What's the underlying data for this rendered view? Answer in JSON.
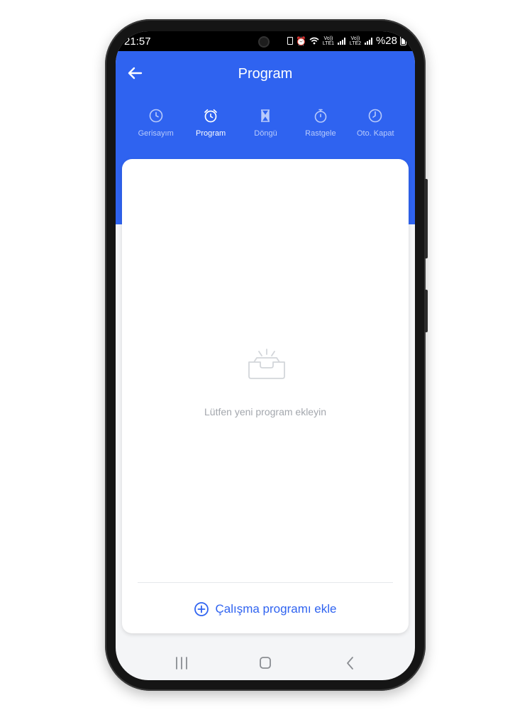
{
  "status": {
    "time": "21:57",
    "carrier1": "Vo)) LTE1",
    "carrier2": "Vo)) LTE2",
    "battery": "%28"
  },
  "header": {
    "title": "Program"
  },
  "tabs": [
    {
      "label": "Gerisayım",
      "icon": "clock-icon",
      "active": false
    },
    {
      "label": "Program",
      "icon": "alarm-clock-icon",
      "active": true
    },
    {
      "label": "Döngü",
      "icon": "hourglass-icon",
      "active": false
    },
    {
      "label": "Rastgele",
      "icon": "stopwatch-icon",
      "active": false
    },
    {
      "label": "Oto. Kapat",
      "icon": "timer-icon",
      "active": false
    }
  ],
  "empty_state": {
    "icon": "empty-inbox-icon",
    "message": "Lütfen yeni program ekleyin"
  },
  "add_button": {
    "label": "Çalışma programı ekle",
    "icon": "plus-circle-icon"
  },
  "colors": {
    "accent": "#2f63f0",
    "background": "#f4f5f7",
    "muted_text": "#a3a7ad"
  }
}
